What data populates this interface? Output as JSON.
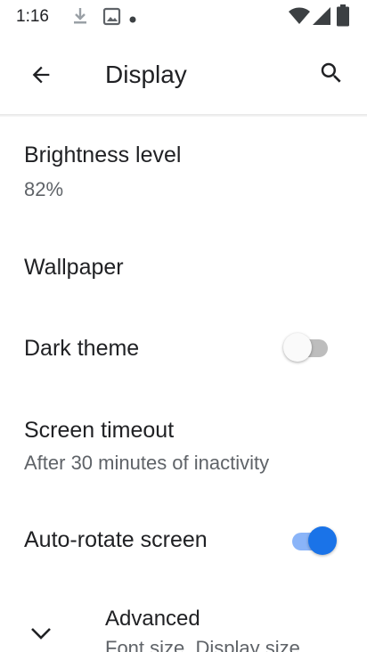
{
  "status_bar": {
    "time": "1:16",
    "icons": [
      "download-icon",
      "gallery-icon",
      "dot-icon",
      "wifi-icon",
      "signal-icon",
      "battery-icon"
    ]
  },
  "app_bar": {
    "title": "Display",
    "back_icon": "arrow-back-icon",
    "search_icon": "search-icon"
  },
  "settings": {
    "brightness": {
      "title": "Brightness level",
      "value": "82%"
    },
    "wallpaper": {
      "title": "Wallpaper"
    },
    "dark_theme": {
      "title": "Dark theme",
      "enabled": false
    },
    "screen_timeout": {
      "title": "Screen timeout",
      "subtitle": "After 30 minutes of inactivity"
    },
    "auto_rotate": {
      "title": "Auto-rotate screen",
      "enabled": true
    },
    "advanced": {
      "title": "Advanced",
      "subtitle": "Font size, Display size, ..."
    }
  },
  "colors": {
    "accent": "#1a73e8",
    "accent_track": "#8ab4f8",
    "text_primary": "#202124",
    "text_secondary": "#5f6368"
  }
}
